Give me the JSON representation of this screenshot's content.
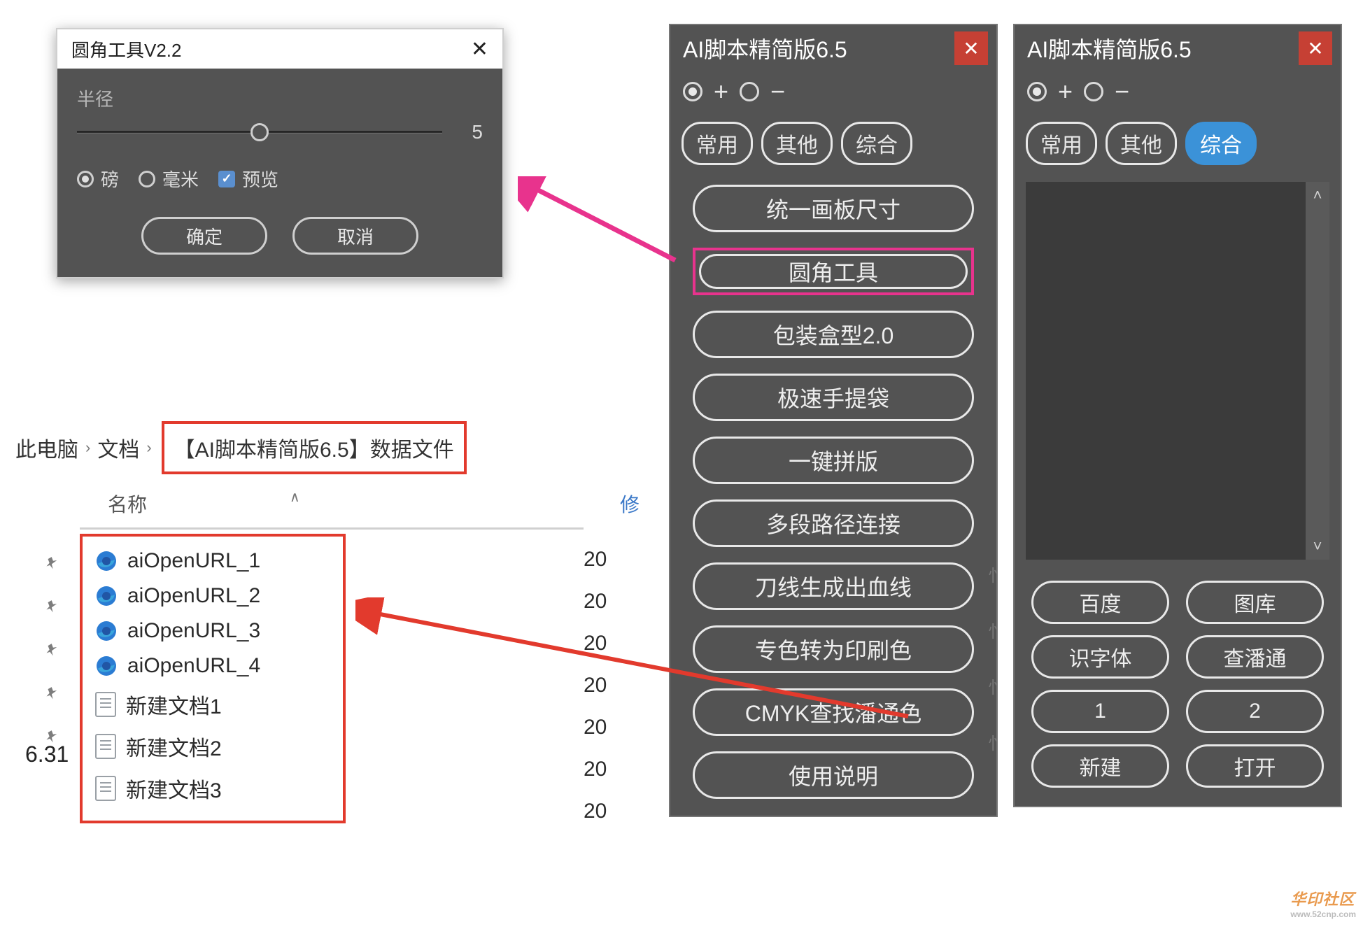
{
  "dialog": {
    "title": "圆角工具V2.2",
    "radius_label": "半径",
    "radius_value": "5",
    "unit_pt": "磅",
    "unit_mm": "毫米",
    "preview": "预览",
    "ok": "确定",
    "cancel": "取消"
  },
  "breadcrumb": {
    "root": "此电脑",
    "docs": "文档",
    "folder": "【AI脚本精简版6.5】数据文件"
  },
  "filelist": {
    "col_name": "名称",
    "col_mod": "修",
    "items": [
      {
        "name": "aiOpenURL_1",
        "icon": "edge",
        "date": "20"
      },
      {
        "name": "aiOpenURL_2",
        "icon": "edge",
        "date": "20"
      },
      {
        "name": "aiOpenURL_3",
        "icon": "edge",
        "date": "20"
      },
      {
        "name": "aiOpenURL_4",
        "icon": "edge",
        "date": "20"
      },
      {
        "name": "新建文档1",
        "icon": "doc",
        "date": "20"
      },
      {
        "name": "新建文档2",
        "icon": "doc",
        "date": "20"
      },
      {
        "name": "新建文档3",
        "icon": "doc",
        "date": "20"
      }
    ],
    "side_label": "6.31"
  },
  "panel_left": {
    "title": "AI脚本精简版6.5",
    "tabs": {
      "t1": "常用",
      "t2": "其他",
      "t3": "综合"
    },
    "buttons": [
      "统一画板尺寸",
      "圆角工具",
      "包装盒型2.0",
      "极速手提袋",
      "一键拼版",
      "多段路径连接",
      "刀线生成出血线",
      "专色转为印刷色",
      "CMYK查找潘通色",
      "使用说明"
    ]
  },
  "panel_right": {
    "title": "AI脚本精简版6.5",
    "tabs": {
      "t1": "常用",
      "t2": "其他",
      "t3": "综合"
    },
    "grid": [
      "百度",
      "图库",
      "识字体",
      "查潘通",
      "1",
      "2",
      "新建",
      "打开"
    ]
  },
  "sidechars": [
    "忄",
    "忄",
    "忄",
    "忄"
  ],
  "watermark": "华印社区"
}
